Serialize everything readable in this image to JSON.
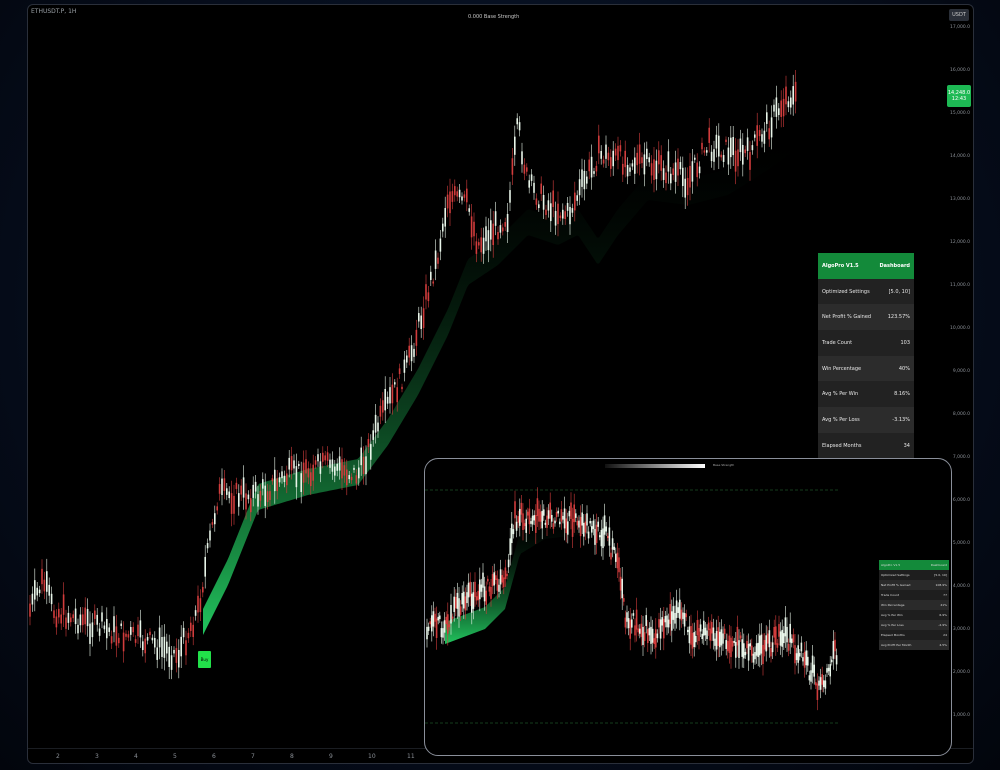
{
  "main_chart": {
    "symbol": "ETHUSDT.P, 1H",
    "title": "0.000 Base Strength",
    "currency_button": "USDT",
    "price_ticks": [
      "17,000.0",
      "16,000.0",
      "15,000.0",
      "14,000.0",
      "13,000.0",
      "12,000.0",
      "11,000.0",
      "10,000.0",
      "9,000.0",
      "8,000.0",
      "7,000.0",
      "6,000.0",
      "5,000.0",
      "4,000.0",
      "3,000.0",
      "2,000.0",
      "1,000.0"
    ],
    "last_price": "14,248.0",
    "last_price_sub": "12:43",
    "time_ticks": [
      "2",
      "3",
      "4",
      "5",
      "6",
      "7",
      "8",
      "9",
      "10",
      "11"
    ],
    "buy_label": "Buy",
    "colors": {
      "band": "#22c55e",
      "bull": "#e8f5e9",
      "bear": "#d23c3c"
    }
  },
  "dashboard": {
    "rows": [
      {
        "label": "AlgoPro V1.5",
        "value": "Dashboard"
      },
      {
        "label": "Optimized Settings",
        "value": "[5.0, 10]"
      },
      {
        "label": "Net Profit % Gained",
        "value": "123.57%"
      },
      {
        "label": "Trade Count",
        "value": "103"
      },
      {
        "label": "Win Percentage",
        "value": "40%"
      },
      {
        "label": "Avg % Per Win",
        "value": "8.16%"
      },
      {
        "label": "Avg % Per Loss",
        "value": "-3.13%"
      },
      {
        "label": "Elapsed Months",
        "value": "34"
      }
    ]
  },
  "inset": {
    "tag": "Base Strength",
    "rows": [
      {
        "label": "AlgoPro V1.5",
        "value": "Dashboard"
      },
      {
        "label": "Optimized Settings",
        "value": "[5.0, 10]"
      },
      {
        "label": "Net Profit % Gained",
        "value": "108.9%"
      },
      {
        "label": "Trade Count",
        "value": "77"
      },
      {
        "label": "Win Percentage",
        "value": "41%"
      },
      {
        "label": "Avg % Per Win",
        "value": "6.9%"
      },
      {
        "label": "Avg % Per Loss",
        "value": "-2.9%"
      },
      {
        "label": "Elapsed Months",
        "value": "24"
      },
      {
        "label": "Avg Profit Per Month",
        "value": "4.5%"
      }
    ]
  }
}
